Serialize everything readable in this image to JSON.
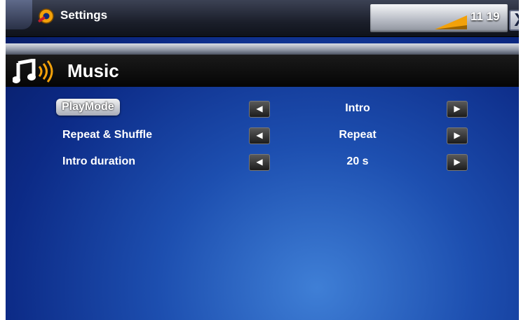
{
  "topbar": {
    "title": "Settings",
    "time": "11 19",
    "close_label": "X",
    "icons": [
      "settings-icon",
      "signal-icon"
    ]
  },
  "section": {
    "title": "Music",
    "icon": "music-icon"
  },
  "rows": [
    {
      "label": "PlayMode",
      "value": "Intro",
      "selected": true
    },
    {
      "label": "Repeat & Shuffle",
      "value": "Repeat",
      "selected": false
    },
    {
      "label": "Intro duration",
      "value": "20 s",
      "selected": false
    }
  ],
  "arrows": {
    "left": "◀",
    "right": "▶"
  },
  "colors": {
    "accent_orange": "#f2a10a",
    "background_blue": "#1d4fb0"
  }
}
